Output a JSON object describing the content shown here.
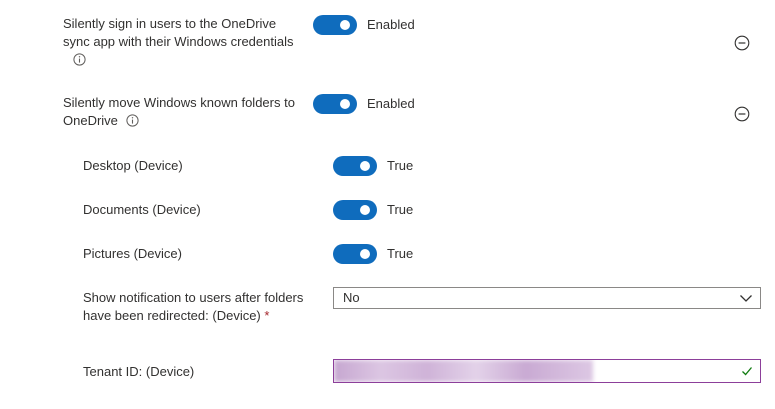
{
  "settings": [
    {
      "label_line1": "Silently sign in users to the OneDrive",
      "label_line2": "sync app with their Windows credentials",
      "state": "Enabled",
      "info_icon": "info-icon",
      "collapse_icon": "minus-circle-icon"
    },
    {
      "label_line1": "Silently move Windows known folders to",
      "label_line2": "OneDrive",
      "state": "Enabled",
      "info_icon": "info-icon",
      "collapse_icon": "minus-circle-icon"
    }
  ],
  "subsettings": [
    {
      "label": "Desktop (Device)",
      "state": "True"
    },
    {
      "label": "Documents (Device)",
      "state": "True"
    },
    {
      "label": "Pictures (Device)",
      "state": "True"
    }
  ],
  "notification": {
    "label_line1": "Show notification to users after folders",
    "label_line2": "have been redirected: (Device)",
    "required_marker": "*",
    "selected_value": "No",
    "chevron_icon": "chevron-down-icon"
  },
  "tenant": {
    "label": "Tenant ID: (Device)",
    "valid_icon": "checkmark-icon"
  },
  "colors": {
    "toggle_on": "#0f6cbd",
    "text": "#323130",
    "required": "#a4262c",
    "valid_check": "#107c10",
    "tenant_border": "#8c3f9a"
  }
}
